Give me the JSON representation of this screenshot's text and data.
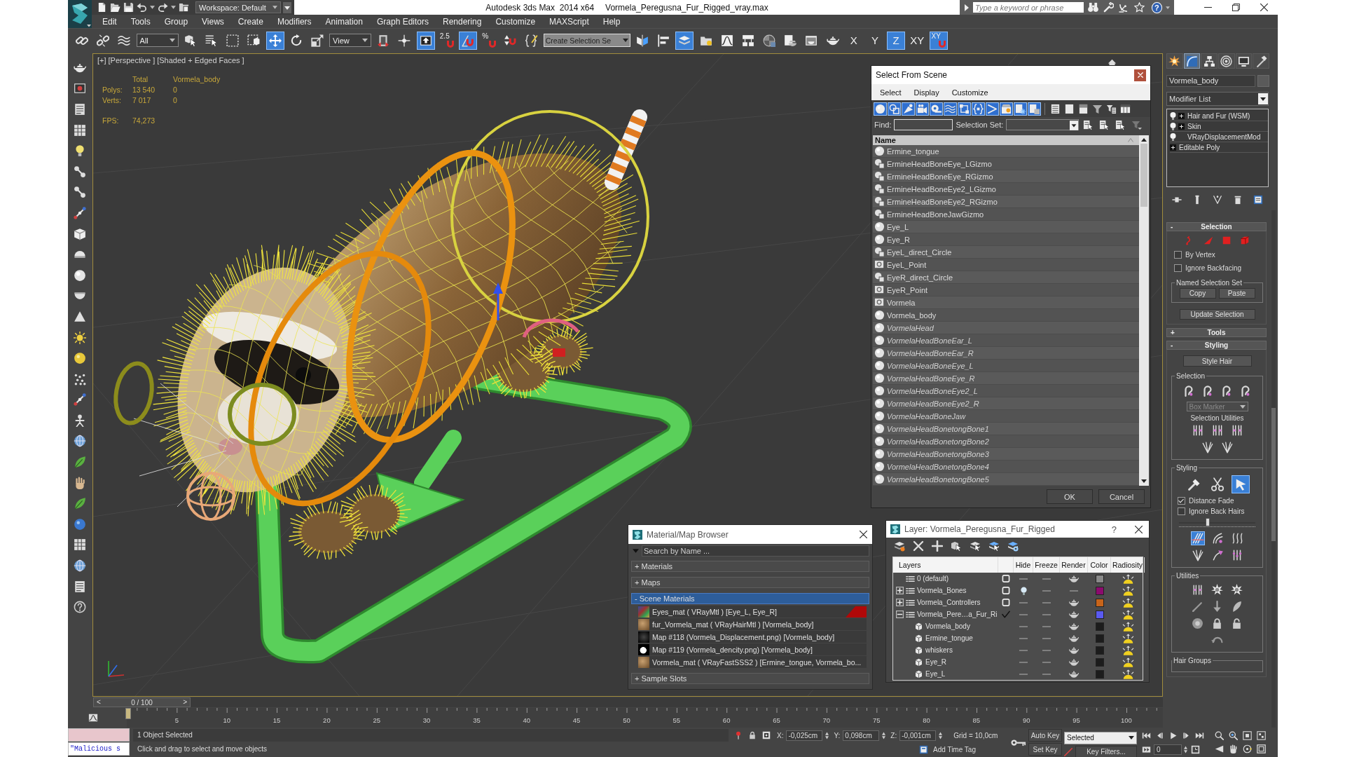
{
  "title_bar": {
    "workspace": "Workspace: Default",
    "app_title": "Autodesk 3ds Max  2014 x64",
    "file_title": "Vormela_Peregusna_Fur_Rigged_vray.max",
    "search_placeholder": "Type a keyword or phrase",
    "help": "?"
  },
  "menu": [
    "Edit",
    "Tools",
    "Group",
    "Views",
    "Create",
    "Modifiers",
    "Animation",
    "Graph Editors",
    "Rendering",
    "Customize",
    "MAXScript",
    "Help"
  ],
  "main_toolbar": [
    {
      "kind": "chain",
      "selected": false
    },
    {
      "kind": "broken_chain",
      "selected": false
    },
    {
      "kind": "wave",
      "selected": false
    },
    {
      "kind": "dropdown",
      "value": "All"
    },
    {
      "kind": "cursor_box",
      "selected": false
    },
    {
      "kind": "list_cursor",
      "selected": false
    },
    {
      "kind": "dashed_rect",
      "selected": false
    },
    {
      "kind": "dashed_cube",
      "selected": false
    },
    {
      "kind": "move",
      "selected": true
    },
    {
      "kind": "rotate",
      "selected": false
    },
    {
      "kind": "scale",
      "selected": false
    },
    {
      "kind": "dropdown",
      "value": "View"
    },
    {
      "kind": "pivot",
      "selected": false
    },
    {
      "kind": "manipulate",
      "selected": false
    },
    {
      "kind": "override",
      "selected": true
    },
    {
      "kind": "snap",
      "label": "2.5",
      "selected": false
    },
    {
      "kind": "angle_snap",
      "selected": true
    },
    {
      "kind": "snap",
      "label": "%",
      "selected": false
    },
    {
      "kind": "spinner_snap",
      "selected": false
    },
    {
      "kind": "braces",
      "selected": false
    },
    {
      "kind": "combo",
      "placeholder": "Create Selection Se"
    },
    {
      "kind": "mirror",
      "selected": false
    },
    {
      "kind": "align",
      "selected": false
    },
    {
      "kind": "layers",
      "selected": true
    },
    {
      "kind": "folder",
      "selected": false
    },
    {
      "kind": "curve",
      "selected": false
    },
    {
      "kind": "schematic",
      "selected": false
    },
    {
      "kind": "material",
      "selected": false
    },
    {
      "kind": "teapot_doc",
      "selected": false
    },
    {
      "kind": "teapot_frame",
      "selected": false
    },
    {
      "kind": "teapot",
      "selected": false
    },
    {
      "kind": "axis",
      "label": "X",
      "selected": false
    },
    {
      "kind": "axis",
      "label": "Y",
      "selected": false
    },
    {
      "kind": "axis",
      "label": "Z",
      "selected": true
    },
    {
      "kind": "axis",
      "label": "XY",
      "selected": false
    },
    {
      "kind": "snap",
      "label": "XY",
      "selected": true
    }
  ],
  "viewport": {
    "labels": [
      "[+]",
      "[Perspective ]",
      "[Shaded + Edged Faces ]"
    ],
    "stats": {
      "columns": [
        "Total",
        "Vormela_body"
      ],
      "rows": [
        {
          "label": "Polys:",
          "values": [
            "13 540",
            "0"
          ]
        },
        {
          "label": "Verts:",
          "values": [
            "7 017",
            "0"
          ]
        }
      ],
      "fps_label": "FPS:",
      "fps": "74,273"
    }
  },
  "select_dialog": {
    "title": "Select From Scene",
    "menu": [
      "Select",
      "Display",
      "Customize"
    ],
    "filters": [
      {
        "kind": "f_sphere",
        "selected": true
      },
      {
        "kind": "f_shapes",
        "selected": true
      },
      {
        "kind": "f_light",
        "selected": true
      },
      {
        "kind": "f_camera",
        "selected": true
      },
      {
        "kind": "f_tape",
        "selected": true
      },
      {
        "kind": "wave",
        "selected": true
      },
      {
        "kind": "f_group",
        "selected": true
      },
      {
        "kind": "f_braces",
        "selected": true
      },
      {
        "kind": "f_chevron",
        "selected": true
      },
      {
        "kind": "f_container",
        "selected": true
      },
      {
        "kind": "f_frozen",
        "selected": true
      },
      {
        "kind": "f_hidden",
        "selected": true
      }
    ],
    "find_label": "Find:",
    "set_label": "Selection Set:",
    "column": "Name",
    "items": [
      {
        "name": "Ermine_tongue",
        "kind": "geometry",
        "italic": false
      },
      {
        "name": "ErmineHeadBoneEye_LGizmo",
        "kind": "shape",
        "italic": false
      },
      {
        "name": "ErmineHeadBoneEye_RGizmo",
        "kind": "shape",
        "italic": false
      },
      {
        "name": "ErmineHeadBoneEye2_LGizmo",
        "kind": "shape",
        "italic": false
      },
      {
        "name": "ErmineHeadBoneEye2_RGizmo",
        "kind": "shape",
        "italic": false
      },
      {
        "name": "ErmineHeadBoneJawGizmo",
        "kind": "shape",
        "italic": false
      },
      {
        "name": "Eye_L",
        "kind": "geometry",
        "italic": false
      },
      {
        "name": "Eye_R",
        "kind": "geometry",
        "italic": false
      },
      {
        "name": "EyeL_direct_Circle",
        "kind": "shape",
        "italic": false
      },
      {
        "name": "EyeL_Point",
        "kind": "helper",
        "italic": false
      },
      {
        "name": "EyeR_direct_Circle",
        "kind": "shape",
        "italic": false
      },
      {
        "name": "EyeR_Point",
        "kind": "helper",
        "italic": false
      },
      {
        "name": "Vormela",
        "kind": "helper",
        "italic": false
      },
      {
        "name": "Vormela_body",
        "kind": "geometry",
        "italic": false
      },
      {
        "name": "VormelaHead",
        "kind": "geometry",
        "italic": true
      },
      {
        "name": "VormelaHeadBoneEar_L",
        "kind": "geometry",
        "italic": true
      },
      {
        "name": "VormelaHeadBoneEar_R",
        "kind": "geometry",
        "italic": true
      },
      {
        "name": "VormelaHeadBoneEye_L",
        "kind": "geometry",
        "italic": true
      },
      {
        "name": "VormelaHeadBoneEye_R",
        "kind": "geometry",
        "italic": true
      },
      {
        "name": "VormelaHeadBoneEye2_L",
        "kind": "geometry",
        "italic": true
      },
      {
        "name": "VormelaHeadBoneEye2_R",
        "kind": "geometry",
        "italic": true
      },
      {
        "name": "VormelaHeadBoneJaw",
        "kind": "geometry",
        "italic": true
      },
      {
        "name": "VormelaHeadBonetongBone1",
        "kind": "geometry",
        "italic": true
      },
      {
        "name": "VormelaHeadBonetongBone2",
        "kind": "geometry",
        "italic": true
      },
      {
        "name": "VormelaHeadBonetongBone3",
        "kind": "geometry",
        "italic": true
      },
      {
        "name": "VormelaHeadBonetongBone4",
        "kind": "geometry",
        "italic": true
      },
      {
        "name": "VormelaHeadBonetongBone5",
        "kind": "geometry",
        "italic": true
      }
    ],
    "buttons": [
      "OK",
      "Cancel"
    ]
  },
  "material_browser": {
    "title": "Material/Map Browser",
    "search_placeholder": "Search by Name ...",
    "groups": [
      {
        "label": "+ Materials",
        "selected": false
      },
      {
        "label": "+ Maps",
        "selected": false
      },
      {
        "label": "- Scene Materials",
        "selected": true,
        "items": [
          {
            "label": "Eyes_mat ( VRayMtl ) [Eye_L, Eye_R]",
            "kind": "eyes",
            "hot": true
          },
          {
            "label": "fur_Vormela_mat ( VRayHairMtl ) [Vormela_body]",
            "kind": "fur",
            "hot": false
          },
          {
            "label": "Map #118 (Vormela_Displacement.png) [Vormela_body]",
            "kind": "displacement",
            "hot": false
          },
          {
            "label": "Map #119 (Vormela_dencity.png) [Vormela_body]",
            "kind": "density",
            "hot": false
          },
          {
            "label": "Vormela_mat ( VRayFastSSS2 ) [Ermine_tongue, Vormela_bo...",
            "kind": "fur",
            "hot": false
          }
        ]
      },
      {
        "label": "+ Sample Slots",
        "selected": false
      }
    ]
  },
  "layer_dialog": {
    "title": "Layer: Vormela_Peregusna_Fur_Rigged",
    "help": "?",
    "columns": [
      "Layers",
      "Hide",
      "Freeze",
      "Render",
      "Color",
      "Radiosity"
    ],
    "layers": [
      {
        "name": "0 (default)",
        "expandable": false,
        "expanded": false,
        "current": false,
        "hidden": false,
        "frozen": false,
        "renderable": true,
        "color": "#8a8a8a"
      },
      {
        "name": "Vormela_Bones",
        "expandable": true,
        "expanded": false,
        "current": false,
        "hidden": true,
        "frozen": false,
        "renderable": false,
        "color": "#8c0a6e"
      },
      {
        "name": "Vormela_Controllers",
        "expandable": true,
        "expanded": false,
        "current": false,
        "hidden": false,
        "frozen": false,
        "renderable": true,
        "color": "#c8641a"
      },
      {
        "name": "Vormela_Pere…a_Fur_Ri",
        "expandable": true,
        "expanded": true,
        "current": true,
        "hidden": false,
        "frozen": false,
        "renderable": true,
        "color": "#5a5af0",
        "children": [
          {
            "name": "Vormela_body",
            "hidden": false,
            "frozen": false,
            "renderable": true,
            "color": "#1c1c1c"
          },
          {
            "name": "Ermine_tongue",
            "hidden": false,
            "frozen": false,
            "renderable": true,
            "color": "#1c1c1c"
          },
          {
            "name": "whiskers",
            "hidden": false,
            "frozen": false,
            "renderable": true,
            "color": "#1c1c1c"
          },
          {
            "name": "Eye_R",
            "hidden": false,
            "frozen": false,
            "renderable": true,
            "color": "#1c1c1c"
          },
          {
            "name": "Eye_L",
            "hidden": false,
            "frozen": false,
            "renderable": true,
            "color": "#1c1c1c"
          }
        ]
      }
    ]
  },
  "command_panel": {
    "tabs": [
      {
        "kind": "burst",
        "selected": false
      },
      {
        "kind": "modify",
        "selected": true
      },
      {
        "kind": "hierarchy",
        "selected": false
      },
      {
        "kind": "motion",
        "selected": false
      },
      {
        "kind": "display",
        "selected": false
      },
      {
        "kind": "hammer",
        "selected": false
      }
    ],
    "object_name": "Vormela_body",
    "modifier_list": "Modifier List",
    "stack": [
      {
        "label": "Hair and Fur (WSM)",
        "bulb": true,
        "expandable": true
      },
      {
        "label": "Skin",
        "bulb": true,
        "expandable": true
      },
      {
        "label": "VRayDisplacementMod",
        "bulb": true,
        "expandable": false
      },
      {
        "label": "Editable Poly",
        "bulb": false,
        "expandable": true
      }
    ],
    "selection_rollout": {
      "sign": "-",
      "title": "Selection",
      "checks": [
        {
          "label": "By Vertex",
          "checked": false
        },
        {
          "label": "Ignore Backfacing",
          "checked": false
        }
      ],
      "named_set_title": "Named Selection Set",
      "set_buttons": [
        "Copy",
        "Paste"
      ],
      "update_button": "Update Selection"
    },
    "tools_rollout": {
      "sign": "+",
      "title": "Tools"
    },
    "styling_rollout": {
      "sign": "-",
      "title": "Styling",
      "style_button": "Style Hair",
      "selection_group": {
        "title": "Selection",
        "marker": {
          "value": "Box Marker",
          "disabled": true
        },
        "utilities_title": "Selection Utilities"
      },
      "styling_group": {
        "title": "Styling",
        "brushes": [
          {
            "kind": "comb",
            "selected": false
          },
          {
            "kind": "scissors",
            "selected": false
          },
          {
            "kind": "arrow_cursor",
            "selected": true
          }
        ],
        "checks": [
          {
            "label": "Distance Fade",
            "checked": true
          },
          {
            "label": "Ignore Back Hairs",
            "checked": false
          }
        ],
        "brush_size": {
          "level": 0.38
        },
        "tools": [
          {
            "kind": "strands_slant",
            "selected": true
          },
          {
            "kind": "strands_curl",
            "selected": false
          },
          {
            "kind": "strands_wave",
            "selected": false
          },
          {
            "kind": "strands_fan",
            "selected": false
          },
          {
            "kind": "strands_arrow",
            "selected": false
          },
          {
            "kind": "strands_pins",
            "selected": false
          }
        ]
      },
      "utilities_title": "Utilities",
      "hair_groups_title": "Hair Groups"
    }
  },
  "timeline": {
    "prev": "<",
    "position": "0 / 100",
    "next": ">",
    "level": 0,
    "ticks": [
      "5",
      "10",
      "15",
      "20",
      "25",
      "30",
      "35",
      "40",
      "45",
      "50",
      "55",
      "60",
      "65",
      "70",
      "75",
      "80",
      "85",
      "90",
      "95",
      "100"
    ]
  },
  "status_bar": {
    "listener_output": "\"Malicious s",
    "prompt": "1 Object Selected",
    "hint": "Click and drag to select and move objects",
    "coords": [
      {
        "axis": "X:",
        "value": "-0,025cm"
      },
      {
        "axis": "Y:",
        "value": "0,098cm"
      },
      {
        "axis": "Z:",
        "value": "-0,001cm"
      }
    ],
    "grid": "Grid = 10,0cm",
    "time_tag": "Add Time Tag",
    "auto_key": "Auto Key",
    "key_mode": "Selected",
    "set_key": "Set Key",
    "key_filters": "Key Filters...",
    "frame": "0"
  }
}
